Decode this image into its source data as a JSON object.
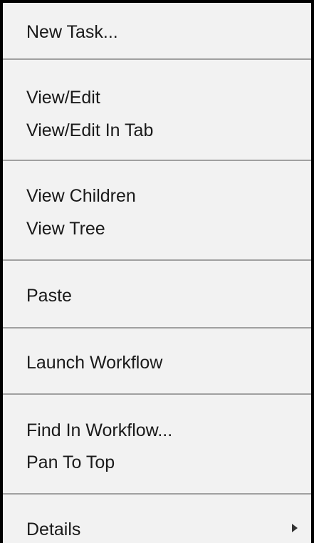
{
  "context_menu": {
    "items": [
      {
        "label": "New Task..."
      },
      {
        "label": "View/Edit"
      },
      {
        "label": "View/Edit In Tab"
      },
      {
        "label": "View Children"
      },
      {
        "label": "View Tree"
      },
      {
        "label": "Paste"
      },
      {
        "label": "Launch Workflow"
      },
      {
        "label": "Find In Workflow..."
      },
      {
        "label": "Pan To Top"
      },
      {
        "label": "Details",
        "submenu_icon": "chevron-right-icon"
      }
    ]
  }
}
